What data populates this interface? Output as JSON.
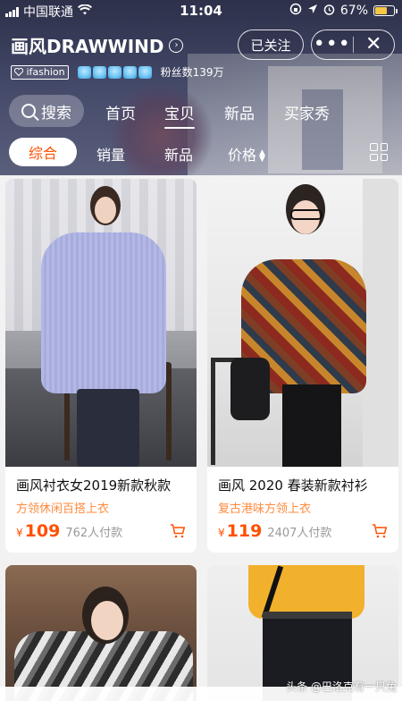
{
  "status_bar": {
    "carrier": "中国联通",
    "time": "11:04",
    "battery": "67%",
    "battery_color": "#f6c744"
  },
  "shop": {
    "name": "画风DRAWWIND",
    "follow_label": "已关注",
    "more_label": "•••",
    "close_label": "✕",
    "platform_badge": "ifashion",
    "fans": "粉丝数139万",
    "crown_count": 5
  },
  "nav": {
    "search_label": "搜索",
    "tabs": [
      {
        "label": "首页",
        "active": false
      },
      {
        "label": "宝贝",
        "active": true
      },
      {
        "label": "新品",
        "active": false
      },
      {
        "label": "买家秀",
        "active": false
      }
    ]
  },
  "sort": {
    "options": [
      {
        "label": "综合",
        "active": true
      },
      {
        "label": "销量",
        "active": false
      },
      {
        "label": "新品",
        "active": false
      },
      {
        "label": "价格",
        "active": false
      }
    ]
  },
  "products": [
    {
      "name": "画风衬衣女2019新款秋款",
      "tag": "方领休闲百搭上衣",
      "currency": "¥",
      "price": "109",
      "buyers": "762人付款"
    },
    {
      "name": "画风 2020 春装新款衬衫",
      "tag": "复古港味方领上衣",
      "currency": "¥",
      "price": "119",
      "buyers": "2407人付款"
    }
  ],
  "watermark": "头条 @巴洛克有一只兔",
  "colors": {
    "accent": "#ff5000",
    "tag": "#ff8a3d"
  }
}
